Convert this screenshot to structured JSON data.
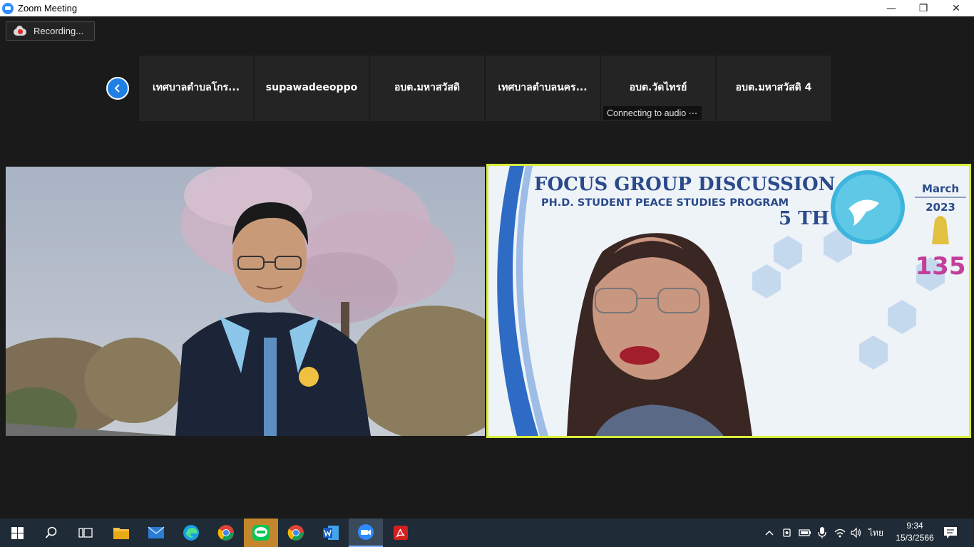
{
  "window": {
    "title": "Zoom Meeting",
    "controls": {
      "minimize": "—",
      "restore": "❐",
      "close": "✕"
    }
  },
  "recording": {
    "label": "Recording..."
  },
  "participants": [
    {
      "name": "เทศบาลตำบลโกร..."
    },
    {
      "name": "supawadeeoppo"
    },
    {
      "name": "อบต.มหาสวัสดิ"
    },
    {
      "name": "เทศบาลตำบลนคร..."
    },
    {
      "name": "อบต.วัดไทรย์",
      "status": "Connecting to audio ⋯"
    },
    {
      "name": "อบต.มหาสวัสดิ 4"
    }
  ],
  "slide": {
    "heading": "FOCUS GROUP DISCUSSION",
    "subheading": "PH.D. STUDENT PEACE STUDIES PROGRAM",
    "edition": "5 TH",
    "month": "March",
    "year": "2023",
    "anniversary": "135"
  },
  "taskbar": {
    "language": "ไทย",
    "time": "9:34",
    "date": "15/3/2566"
  },
  "colors": {
    "accent": "#2D8CFF",
    "active_speaker_border": "#d8ed3a",
    "recording_dot": "#e02828",
    "taskbar_bg": "#1f2b36"
  }
}
